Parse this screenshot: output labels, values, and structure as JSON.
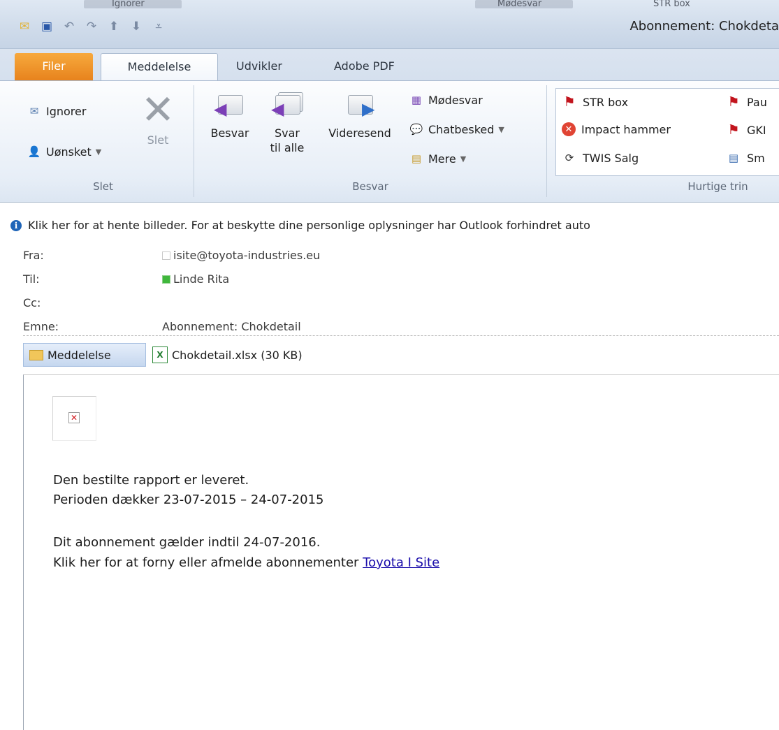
{
  "window": {
    "title": "Abonnement: Chokdeta",
    "background_menu_ghost": [
      "Ignorer",
      "Mødesvar",
      "STR box"
    ]
  },
  "quick_access": {
    "icons": [
      "mail-icon",
      "save-icon",
      "undo-icon",
      "redo-icon",
      "up-icon",
      "down-icon",
      "customize-icon"
    ]
  },
  "tabs": [
    {
      "label": "Filer"
    },
    {
      "label": "Meddelelse"
    },
    {
      "label": "Udvikler"
    },
    {
      "label": "Adobe PDF"
    }
  ],
  "ribbon": {
    "slet_group": {
      "label": "Slet",
      "ignore_label": "Ignorer",
      "junk_label": "Uønsket",
      "delete_label": "Slet"
    },
    "besvar_group": {
      "label": "Besvar",
      "reply_label": "Besvar",
      "reply_all_line1": "Svar",
      "reply_all_line2": "til alle",
      "forward_label": "Videresend",
      "meeting_label": "Mødesvar",
      "im_label": "Chatbesked",
      "more_label": "Mere"
    },
    "quick_steps": {
      "label": "Hurtige trin",
      "items": [
        "STR box",
        "Impact hammer",
        "TWIS Salg",
        "Pau",
        "GKI",
        "Sm"
      ]
    }
  },
  "infobar": {
    "text": "Klik her for at hente billeder. For at beskytte dine personlige oplysninger har Outlook forhindret auto"
  },
  "headers": {
    "from_label": "Fra:",
    "from_value": "isite@toyota-industries.eu",
    "to_label": "Til:",
    "to_value": "Linde Rita",
    "cc_label": "Cc:",
    "subject_label": "Emne:",
    "subject_value": "Abonnement: Chokdetail"
  },
  "attachments": {
    "message_tab": "Meddelelse",
    "file": "Chokdetail.xlsx (30 KB)"
  },
  "body": {
    "line1": "Den bestilte rapport er leveret.",
    "line2": "Perioden dækker 23-07-2015 – 24-07-2015",
    "line3": "Dit abonnement gælder indtil 24-07-2016.",
    "line4_prefix": "Klik her for at forny eller afmelde abonnementer ",
    "link_text": "Toyota I Site"
  },
  "colors": {
    "file_tab": "#e7821c",
    "link": "#1a0dab",
    "flag": "#c2141d",
    "info_icon": "#1f65b8"
  }
}
